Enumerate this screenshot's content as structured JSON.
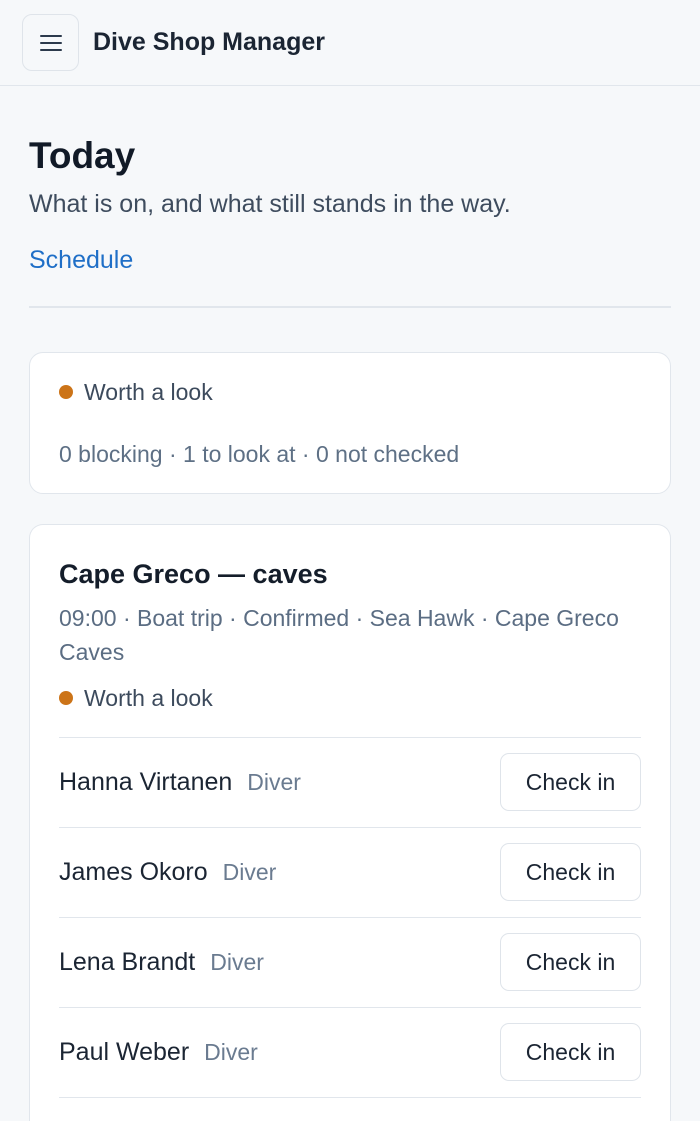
{
  "app": {
    "title": "Dive Shop Manager",
    "menu_icon": "hamburger-menu-icon"
  },
  "page": {
    "title": "Today",
    "subtitle": "What is on, and what still stands in the way.",
    "schedule_link": "Schedule"
  },
  "summary": {
    "status_label": "Worth a look",
    "status_color": "#cc7418",
    "counts": "0 blocking · 1 to look at · 0 not checked"
  },
  "trip": {
    "title": "Cape Greco — caves",
    "meta": "09:00 · Boat trip · Confirmed · Sea Hawk · Cape Greco Caves",
    "status_label": "Worth a look",
    "participants": [
      {
        "name": "Hanna Virtanen",
        "role": "Diver",
        "action": "Check in"
      },
      {
        "name": "James Okoro",
        "role": "Diver",
        "action": "Check in"
      },
      {
        "name": "Lena Brandt",
        "role": "Diver",
        "action": "Check in"
      },
      {
        "name": "Paul Weber",
        "role": "Diver",
        "action": "Check in"
      }
    ]
  },
  "colors": {
    "accent_link": "#1f6fc7",
    "warning_dot": "#cc7418"
  }
}
